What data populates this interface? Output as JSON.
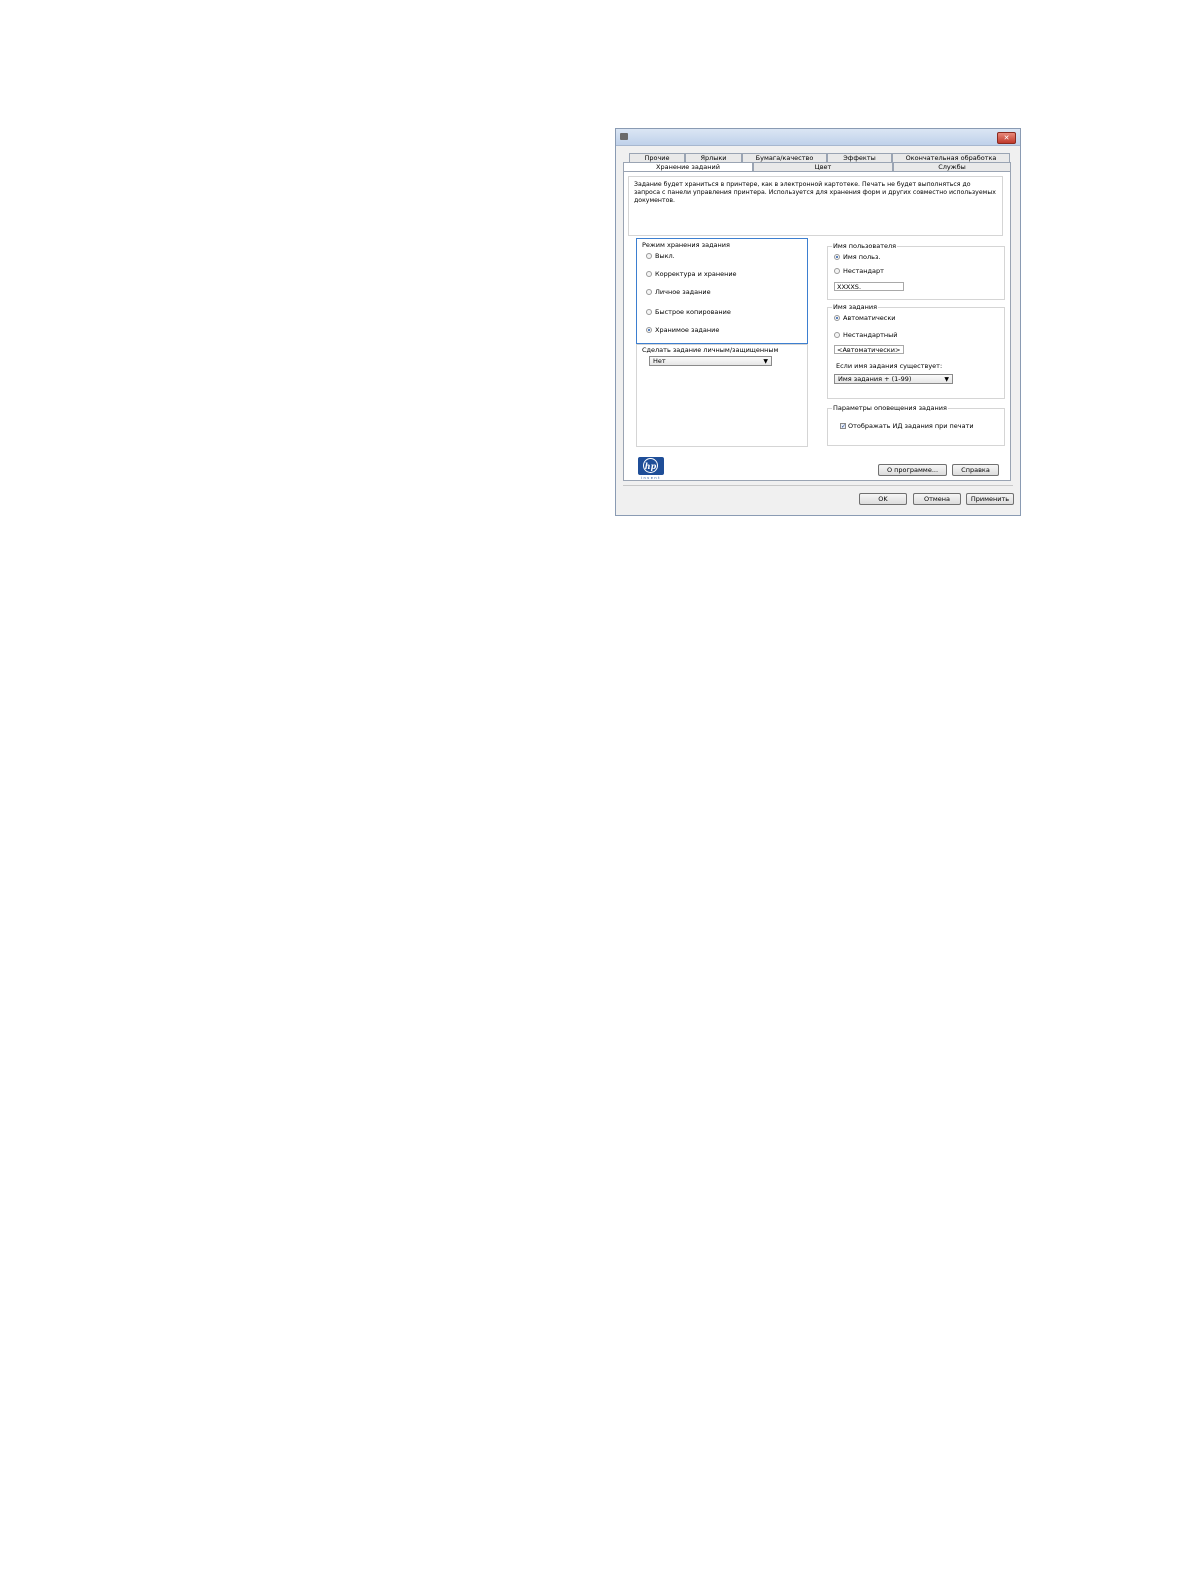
{
  "window": {
    "close_glyph": "✕",
    "close_color": "#c0392b"
  },
  "tabs": {
    "row1": [
      "Прочие",
      "Ярлыки",
      "Бумага/качество",
      "Эффекты",
      "Окончательная обработка"
    ],
    "row2": [
      "Хранение заданий",
      "Цвет",
      "Службы"
    ],
    "active": "Хранение заданий"
  },
  "description": "Задание будет храниться в принтере, как в электронной картотеке. Печать не будет выполняться до запроса с панели управления принтера. Используется для хранения форм и других совместно используемых документов.",
  "storage_mode": {
    "title": "Режим хранения задания",
    "options": [
      "Выкл.",
      "Корректура и хранение",
      "Личное задание",
      "Быстрое копирование",
      "Хранимое задание"
    ],
    "selected": "Хранимое задание",
    "highlight_color": "#3d7fd0"
  },
  "private": {
    "label": "Сделать задание личным/защищенным",
    "value": "Нет"
  },
  "user_name": {
    "title": "Имя пользователя",
    "options": [
      "Имя польз.",
      "Нестандарт"
    ],
    "selected": "Имя польз.",
    "value": "XXXXS."
  },
  "job_name": {
    "title": "Имя задания",
    "options": [
      "Автоматически",
      "Нестандартный"
    ],
    "selected": "Автоматически",
    "value": "<Автоматически>",
    "exists_label": "Если имя задания существует:",
    "exists_value": "Имя задания + (1-99)"
  },
  "notification": {
    "title": "Параметры оповещения задания",
    "checkbox_label": "Отображать ИД задания при печати",
    "checked": true
  },
  "logo": {
    "brand": "hp",
    "sub": "invent",
    "color": "#1f4e98"
  },
  "buttons": {
    "about": "О программе...",
    "help": "Справка",
    "ok": "OK",
    "cancel": "Отмена",
    "apply": "Применить"
  }
}
